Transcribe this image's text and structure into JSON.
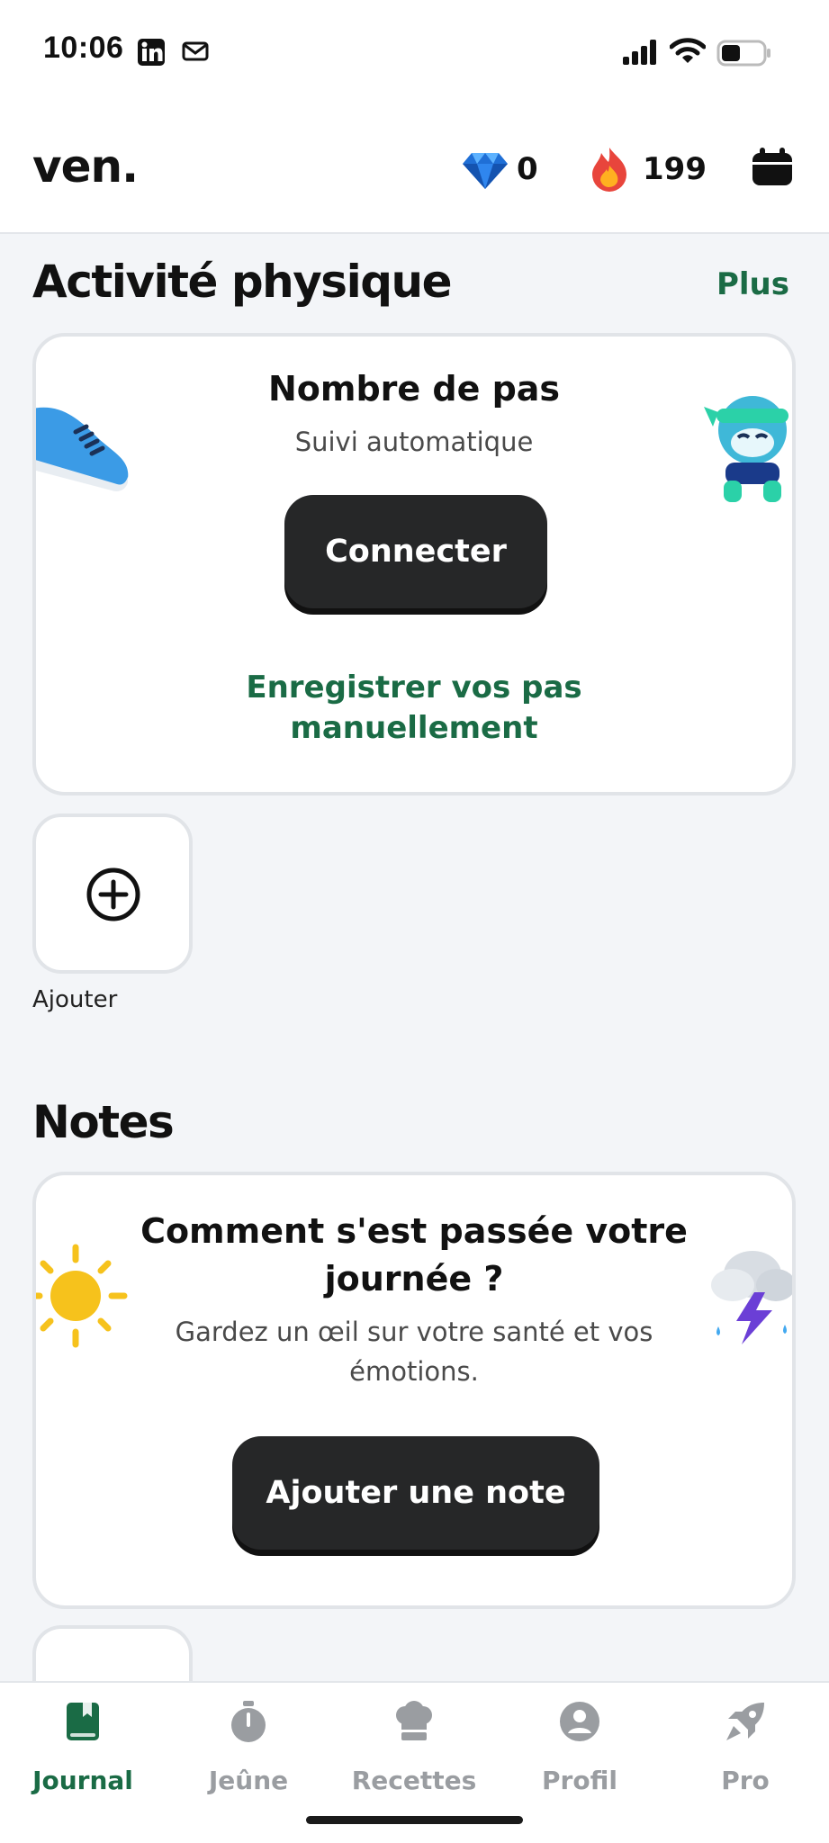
{
  "status_bar": {
    "time": "10:06",
    "icons": [
      "linkedin-icon",
      "mail-icon",
      "signal-icon",
      "wifi-icon",
      "battery-icon"
    ]
  },
  "header": {
    "logo": "ven.",
    "gems": "0",
    "streak": "199"
  },
  "activity": {
    "title": "Activité physique",
    "more_link": "Plus",
    "steps_card": {
      "title": "Nombre de pas",
      "subtitle": "Suivi automatique",
      "button": "Connecter",
      "manual_line1": "Enregistrer vos pas",
      "manual_line2": "manuellement"
    },
    "add_tile_label": "Ajouter"
  },
  "notes": {
    "title": "Notes",
    "card": {
      "title_line1": "Comment s'est passée votre",
      "title_line2": "journée ?",
      "sub_line1": "Gardez un œil sur votre santé et vos",
      "sub_line2": "émotions.",
      "button": "Ajouter une note"
    }
  },
  "bottom_nav": {
    "items": [
      {
        "label": "Journal",
        "icon": "journal-icon",
        "active": true
      },
      {
        "label": "Jeûne",
        "icon": "stopwatch-icon",
        "active": false
      },
      {
        "label": "Recettes",
        "icon": "chef-hat-icon",
        "active": false
      },
      {
        "label": "Profil",
        "icon": "profile-icon",
        "active": false
      },
      {
        "label": "Pro",
        "icon": "rocket-icon",
        "active": false
      }
    ]
  },
  "colors": {
    "accent_green": "#1a6b45",
    "button_dark": "#262728",
    "background": "#f3f5f8",
    "nav_inactive": "#9a9da1"
  }
}
